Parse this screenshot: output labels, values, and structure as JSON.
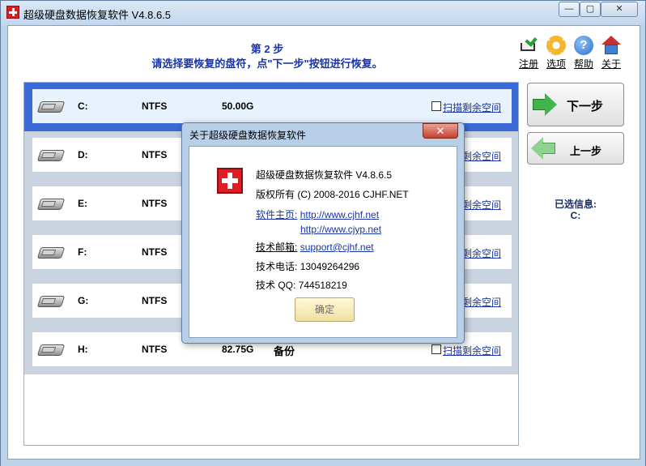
{
  "window": {
    "title": "超级硬盘数据恢复软件 V4.8.6.5",
    "minimize": "—",
    "maximize": "▢",
    "close": "✕"
  },
  "header": {
    "step_title": "第 2 步",
    "instruction": "请选择要恢复的盘符，点\"下一步\"按钮进行恢复。"
  },
  "tools": [
    {
      "label": "注册",
      "icon": "cart-check-icon"
    },
    {
      "label": "选项",
      "icon": "gear-icon"
    },
    {
      "label": "帮助",
      "icon": "help-icon"
    },
    {
      "label": "关于",
      "icon": "house-icon"
    }
  ],
  "drives": [
    {
      "letter": "C:",
      "fs": "NTFS",
      "size": "50.00G",
      "note": "",
      "scan": "扫描剩余空间",
      "selected": true
    },
    {
      "letter": "D:",
      "fs": "NTFS",
      "size": "",
      "note": "",
      "scan": "扫描剩余空间",
      "selected": false
    },
    {
      "letter": "E:",
      "fs": "NTFS",
      "size": "",
      "note": "",
      "scan": "扫描剩余空间",
      "selected": false
    },
    {
      "letter": "F:",
      "fs": "NTFS",
      "size": "",
      "note": "",
      "scan": "扫描剩余空间",
      "selected": false
    },
    {
      "letter": "G:",
      "fs": "NTFS",
      "size": "",
      "note": "",
      "scan": "扫描剩余空间",
      "selected": false
    },
    {
      "letter": "H:",
      "fs": "NTFS",
      "size": "82.75G",
      "note": "备份",
      "scan": "扫描剩余空间",
      "selected": false
    }
  ],
  "nav": {
    "next_label": "下一步",
    "prev_label": "上一步"
  },
  "selection": {
    "label": "已选信息:",
    "value": "C:"
  },
  "dialog": {
    "title": "关于超级硬盘数据恢复软件",
    "close": "✕",
    "product": "超级硬盘数据恢复软件 V4.8.6.5",
    "copyright": "版权所有 (C) 2008-2016 CJHF.NET",
    "homepage_label": "软件主页:",
    "homepage_url1": "http://www.cjhf.net",
    "homepage_url2": "http://www.cjyp.net",
    "email_label": "技术邮箱:",
    "email": "support@cjhf.net",
    "phone_label": "技术电话:",
    "phone": "13049264296",
    "qq_label": "技术  QQ:",
    "qq": "744518219",
    "ok": "确定"
  }
}
